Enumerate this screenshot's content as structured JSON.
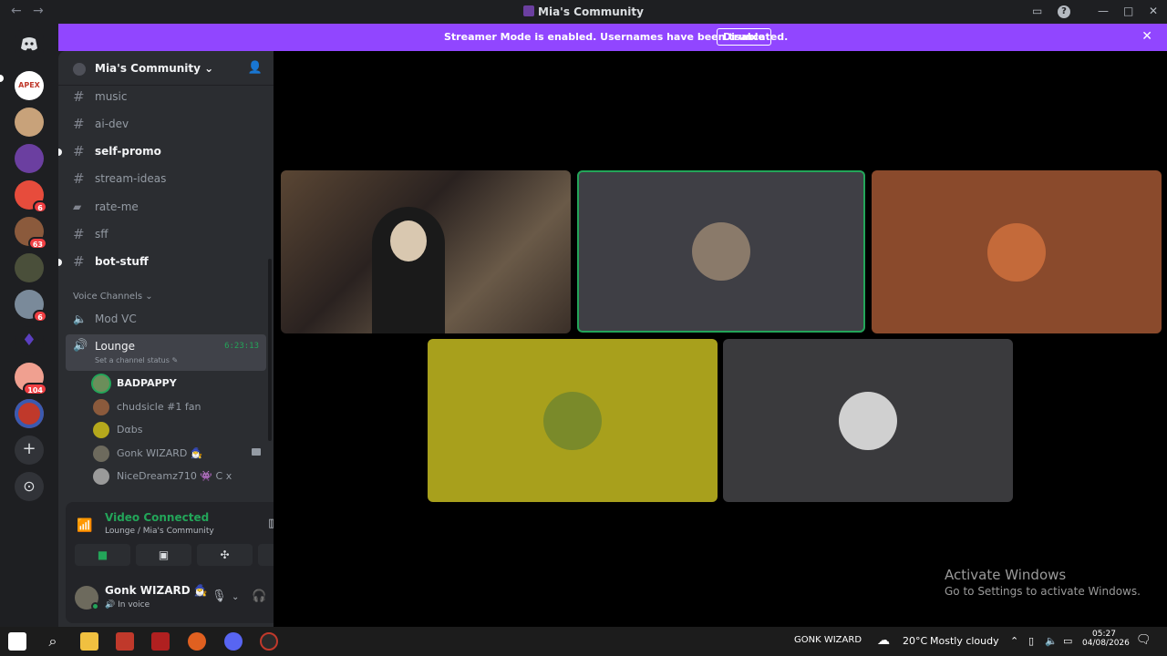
{
  "window": {
    "title": "Mia's Community",
    "nav_back": "←",
    "nav_forward": "→",
    "inbox": "▭",
    "help": "?",
    "minimize": "—",
    "maximize": "□",
    "close": "✕"
  },
  "banner": {
    "message": "Streamer Mode is enabled. Usernames have been truncated.",
    "button": "Disable",
    "close": "✕"
  },
  "rail": {
    "servers": [
      {
        "name": "Discord Home",
        "color": "#1e1f22",
        "badge": ""
      },
      {
        "name": "APEX",
        "color": "#ffffff",
        "badge": ""
      },
      {
        "name": "Server 2",
        "color": "#c8a27a",
        "badge": ""
      },
      {
        "name": "Server 3",
        "color": "#6b3fa0",
        "badge": ""
      },
      {
        "name": "Server 4",
        "color": "#e74c3c",
        "badge": "6"
      },
      {
        "name": "Server 5",
        "color": "#8b5a3c",
        "badge": "63"
      },
      {
        "name": "Server 6",
        "color": "#4a4f3a",
        "badge": ""
      },
      {
        "name": "Server 7",
        "color": "#7a8a9a",
        "badge": "6"
      },
      {
        "name": "Server 8",
        "color": "#5b3fc0",
        "badge": ""
      },
      {
        "name": "Server 9",
        "color": "#f0a090",
        "badge": "104"
      },
      {
        "name": "Server 10",
        "color": "#c0392b",
        "badge": ""
      }
    ],
    "add_server": "+",
    "discover": "⊙"
  },
  "sidebar": {
    "guild_name": "Mia's Community",
    "channels": [
      {
        "name": "music",
        "unread": false
      },
      {
        "name": "ai-dev",
        "unread": false
      },
      {
        "name": "self-promo",
        "unread": true
      },
      {
        "name": "stream-ideas",
        "unread": false
      },
      {
        "name": "rate-me",
        "unread": false
      },
      {
        "name": "sff",
        "unread": false
      },
      {
        "name": "bot-stuff",
        "unread": true
      }
    ],
    "voice_category": "Voice Channels",
    "voice_channels": [
      {
        "name": "Mod VC"
      }
    ],
    "lounge": {
      "name": "Lounge",
      "timer": "6:23:13",
      "status": "Set a channel status"
    },
    "members": [
      {
        "name": "BADPAPPY",
        "speaking": true,
        "color": "#6b8e5a",
        "camera": false
      },
      {
        "name": "chudsicle #1 fan",
        "speaking": false,
        "color": "#8b5a3c",
        "camera": false
      },
      {
        "name": "Dαbs",
        "speaking": false,
        "color": "#b5a81c",
        "camera": false
      },
      {
        "name": "Gonk WIZARD 🧙‍♂️",
        "speaking": false,
        "color": "#6d6a5d",
        "camera": true
      },
      {
        "name": "NiceDreamz710 👾 C x",
        "speaking": false,
        "color": "#9a9a9a",
        "camera": false
      }
    ]
  },
  "voice_panel": {
    "title": "Video Connected",
    "subtitle": "Lounge / Mia's Community"
  },
  "user": {
    "name": "Gonk WIZARD 🧙‍♂️",
    "status": "In voice"
  },
  "tiles": [
    {
      "name": "streamer-camera",
      "color": "#3b2f2a",
      "active": false
    },
    {
      "name": "participant-2",
      "color": "#3f3f45",
      "active": true,
      "avatar": "#8a7a6a"
    },
    {
      "name": "participant-3",
      "color": "#8a4a2c",
      "active": false,
      "avatar": "#c46a3a"
    },
    {
      "name": "participant-4",
      "color": "#a8a01c",
      "active": false,
      "avatar": "#7a8a2a"
    },
    {
      "name": "participant-5",
      "color": "#3a3a3d",
      "active": false,
      "avatar": "#d0d0d0"
    }
  ],
  "watermark": {
    "line1": "Activate Windows",
    "line2": "Go to Settings to activate Windows."
  },
  "taskbar": {
    "user": "GONK WIZARD",
    "temperature": "20°C",
    "weather": "Mostly cloudy",
    "time": "05:27",
    "date": "04/08/2026"
  }
}
